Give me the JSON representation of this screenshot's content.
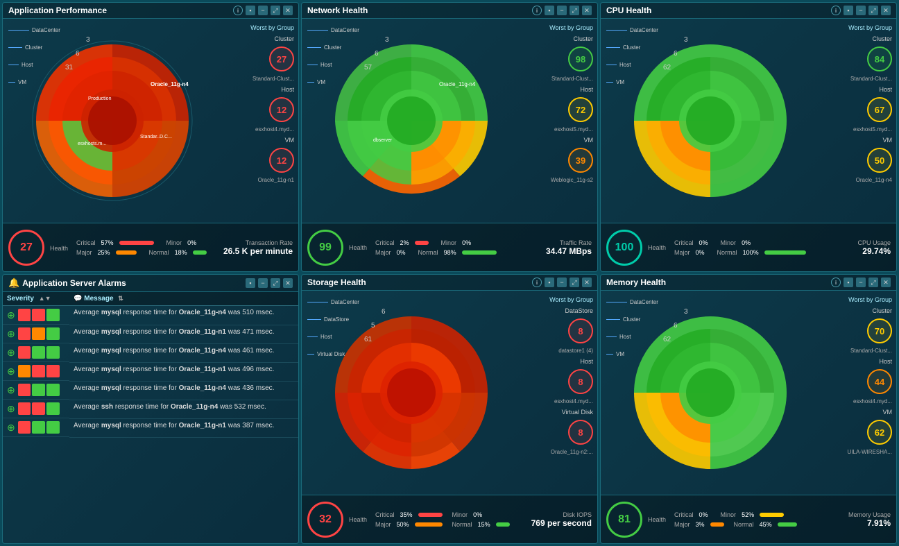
{
  "panels": {
    "app_performance": {
      "title": "Application Performance",
      "worst_by_group": {
        "title": "Worst by Group",
        "cluster_label": "Cluster",
        "cluster_value": "27",
        "cluster_name": "Standard-Clust...",
        "host_label": "Host",
        "host_value": "12",
        "host_name": "esxhost4.myd...",
        "vm_label": "VM",
        "vm_value": "12",
        "vm_name": "Oracle_11g-n1"
      },
      "legend": {
        "datacenter": "DataCenter",
        "cluster": "Cluster",
        "host": "Host",
        "vm": "VM",
        "vals": [
          "3",
          "6",
          "31"
        ]
      },
      "status": {
        "health_value": "27",
        "health_color": "red",
        "health_label": "Health",
        "critical_pct": "57%",
        "major_pct": "25%",
        "minor_pct": "0%",
        "normal_pct": "18%",
        "metric_title": "Transaction Rate",
        "metric_value": "26.5 K per minute"
      }
    },
    "network_health": {
      "title": "Network Health",
      "worst_by_group": {
        "title": "Worst by Group",
        "cluster_label": "Cluster",
        "cluster_value": "98",
        "cluster_name": "Standard-Clust...",
        "host_label": "Host",
        "host_value": "72",
        "host_name": "esxhost5.myd...",
        "vm_label": "VM",
        "vm_value": "39",
        "vm_name": "Weblogic_11g-s2"
      },
      "legend": {
        "datacenter": "DataCenter",
        "cluster": "Cluster",
        "host": "Host",
        "vm": "VM",
        "vals": [
          "3",
          "6",
          "57"
        ]
      },
      "status": {
        "health_value": "99",
        "health_color": "green",
        "health_label": "Health",
        "critical_pct": "2%",
        "major_pct": "0%",
        "minor_pct": "0%",
        "normal_pct": "98%",
        "metric_title": "Traffic Rate",
        "metric_value": "34.47 MBps"
      }
    },
    "cpu_health": {
      "title": "CPU Health",
      "worst_by_group": {
        "title": "Worst by Group",
        "cluster_label": "Cluster",
        "cluster_value": "84",
        "cluster_name": "Standard-Clust...",
        "host_label": "Host",
        "host_value": "67",
        "host_name": "esxhost5.myd...",
        "vm_label": "VM",
        "vm_value": "50",
        "vm_name": "Oracle_11g-n4"
      },
      "legend": {
        "datacenter": "DataCenter",
        "cluster": "Cluster",
        "host": "Host",
        "vm": "VM",
        "vals": [
          "3",
          "6",
          "62"
        ]
      },
      "status": {
        "health_value": "100",
        "health_color": "teal",
        "health_label": "Health",
        "critical_pct": "0%",
        "major_pct": "0%",
        "minor_pct": "0%",
        "normal_pct": "100%",
        "metric_title": "CPU Usage",
        "metric_value": "29.74%"
      }
    },
    "app_server_alarms": {
      "title": "Application Server Alarms",
      "columns": [
        "Severity",
        "Message"
      ],
      "alarms": [
        {
          "msg": "Average mysql response time for Oracle_11g-n4 was 510 msec."
        },
        {
          "msg": "Average mysql response time for Oracle_11g-n1 was 471 msec."
        },
        {
          "msg": "Average mysql response time for Oracle_11g-n4 was 461 msec."
        },
        {
          "msg": "Average mysql response time for Oracle_11g-n1 was 496 msec."
        },
        {
          "msg": "Average mysql response time for Oracle_11g-n4 was 436 msec."
        },
        {
          "msg": "Average ssh response time for Oracle_11g-n4 was 532 msec."
        },
        {
          "msg": "Average mysql response time for Oracle_11g-n1 was 387 msec."
        }
      ]
    },
    "storage_health": {
      "title": "Storage Health",
      "worst_by_group": {
        "title": "Worst by Group",
        "datastore_label": "DataStore",
        "datastore_value": "8",
        "datastore_name": "datastore1 (4)",
        "host_label": "Host",
        "host_value": "8",
        "host_name": "esxhost4.myd...",
        "virtual_disk_label": "Virtual Disk",
        "virtual_disk_value": "8",
        "virtual_disk_name": "Oracle_11g-n2:..."
      },
      "legend": {
        "datacenter": "DataCenter",
        "datastore": "DataStore",
        "host": "Host",
        "virtual_disk": "Virtual Disk",
        "vals": [
          "6",
          "5",
          "61"
        ]
      },
      "status": {
        "health_value": "32",
        "health_color": "red",
        "health_label": "Health",
        "critical_pct": "35%",
        "major_pct": "50%",
        "minor_pct": "0%",
        "normal_pct": "15%",
        "metric_title": "Disk IOPS",
        "metric_value": "769 per second"
      }
    },
    "memory_health": {
      "title": "Memory Health",
      "worst_by_group": {
        "title": "Worst by Group",
        "cluster_label": "Cluster",
        "cluster_value": "70",
        "cluster_name": "Standard-Clust...",
        "host_label": "Host",
        "host_value": "44",
        "host_name": "esxhost4.myd...",
        "vm_label": "VM",
        "vm_value": "62",
        "vm_name": "UILA-WIRESHA..."
      },
      "legend": {
        "datacenter": "DataCenter",
        "cluster": "Cluster",
        "host": "Host",
        "vm": "VM",
        "vals": [
          "3",
          "6",
          "62"
        ]
      },
      "status": {
        "health_value": "81",
        "health_color": "green",
        "health_label": "Health",
        "critical_pct": "0%",
        "major_pct": "3%",
        "minor_pct": "52%",
        "normal_pct": "45%",
        "metric_title": "Memory Usage",
        "metric_value": "7.91%"
      }
    }
  }
}
